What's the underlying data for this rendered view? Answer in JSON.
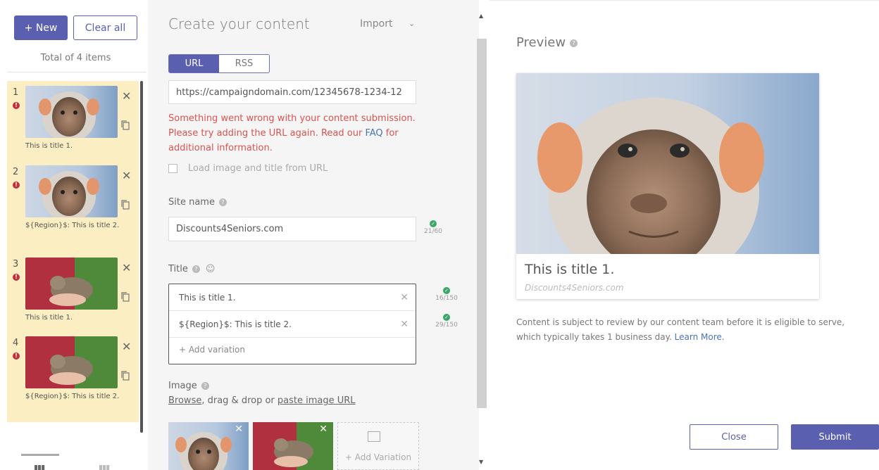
{
  "left": {
    "new_label": "+ New",
    "clear_label": "Clear all",
    "total_text": "Total of 4 items",
    "items": [
      {
        "num": "1",
        "title": "This is title 1.",
        "image": "monkey"
      },
      {
        "num": "2",
        "title": "${Region}$: This is title 2.",
        "image": "monkey"
      },
      {
        "num": "3",
        "title": "This is title 1.",
        "image": "rabbit"
      },
      {
        "num": "4",
        "title": "${Region}$: This is title 2.",
        "image": "rabbit"
      }
    ]
  },
  "form": {
    "heading": "Create your content",
    "import_label": "Import",
    "tabs": [
      "URL",
      "RSS"
    ],
    "url_value": "https://campaigndomain.com/12345678-1234-12",
    "error_before": "Something went wrong with your content submission. Please try adding the URL again. Read our ",
    "error_link": "FAQ",
    "error_after": " for additional information.",
    "load_checkbox_label": "Load image and title from URL",
    "site_name_label": "Site name",
    "site_name_value": "Discounts4Seniors.com",
    "site_name_counter": "21/60",
    "title_label": "Title",
    "titles": [
      {
        "value": "This is title 1.",
        "counter": "16/150"
      },
      {
        "value": "${Region}$:  This is title 2.",
        "counter": "29/150"
      }
    ],
    "add_variation": "+ Add variation",
    "image_label": "Image",
    "image_help_browse": "Browse",
    "image_help_mid": ", drag & drop or ",
    "image_help_paste": "paste image URL",
    "image_add_variation": "+ Add Variation"
  },
  "preview": {
    "heading": "Preview",
    "card_title": "This is title 1.",
    "card_site": "Discounts4Seniors.com",
    "note": "Content is subject to review by our content team before it is eligible to serve, which typically takes 1 business day. ",
    "learn_more": "Learn More.",
    "close_label": "Close",
    "submit_label": "Submit"
  },
  "colors": {
    "accent": "#5a5fb0",
    "error": "#d9534f",
    "ok": "#3aa766",
    "list_bg": "#fbeec2"
  }
}
